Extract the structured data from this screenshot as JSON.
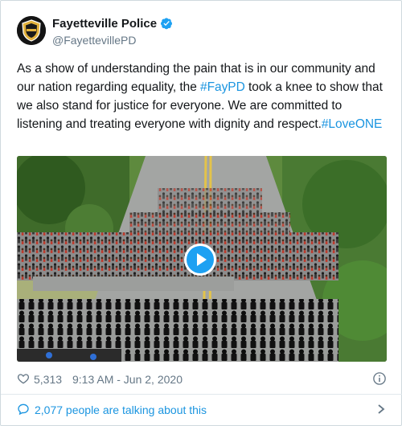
{
  "account": {
    "display_name": "Fayetteville Police",
    "handle": "@FayettevillePD",
    "verified": true,
    "avatar_icon": "police-badge-icon"
  },
  "tweet": {
    "text_before": "As a show of understanding the pain that is in our community and our nation regarding equality, the ",
    "hashtag_1": "#FayPD",
    "text_middle": " took a knee to show that we also stand for justice for everyone. We are committed to listening and treating everyone with dignity and respect.",
    "hashtag_2": "#LoveONE"
  },
  "media": {
    "type": "video",
    "description_icon": "play-icon"
  },
  "meta": {
    "likes": "5,313",
    "timestamp": "9:13 AM - Jun 2, 2020"
  },
  "conversation": {
    "label": "2,077 people are talking about this"
  },
  "colors": {
    "link": "#1b95e0",
    "text": "#14171a",
    "muted": "#657786",
    "verified": "#1da1f2"
  }
}
